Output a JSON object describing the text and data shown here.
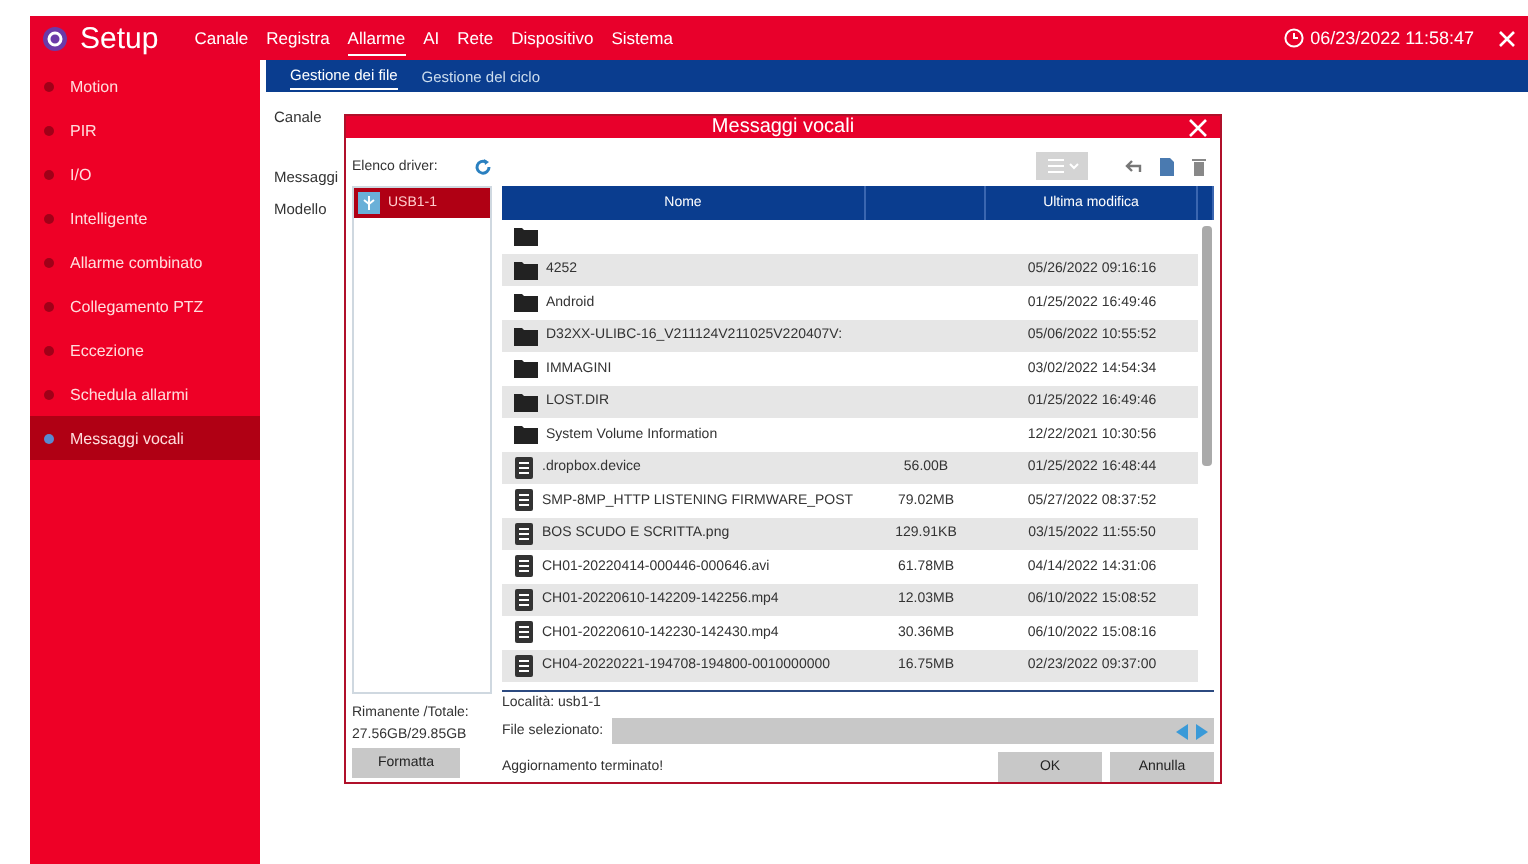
{
  "header": {
    "title": "Setup",
    "nav": [
      {
        "label": "Canale",
        "selected": false
      },
      {
        "label": "Registra",
        "selected": false
      },
      {
        "label": "Allarme",
        "selected": true
      },
      {
        "label": "AI",
        "selected": false
      },
      {
        "label": "Rete",
        "selected": false
      },
      {
        "label": "Dispositivo",
        "selected": false
      },
      {
        "label": "Sistema",
        "selected": false
      }
    ],
    "datetime": "06/23/2022 11:58:47"
  },
  "sidebar": {
    "items": [
      {
        "label": "Motion",
        "selected": false
      },
      {
        "label": "PIR",
        "selected": false
      },
      {
        "label": "I/O",
        "selected": false
      },
      {
        "label": "Intelligente",
        "selected": false
      },
      {
        "label": "Allarme combinato",
        "selected": false
      },
      {
        "label": "Collegamento PTZ",
        "selected": false
      },
      {
        "label": "Eccezione",
        "selected": false
      },
      {
        "label": "Schedula allarmi",
        "selected": false
      },
      {
        "label": "Messaggi vocali",
        "selected": true
      }
    ]
  },
  "subtabs": [
    {
      "label": "Gestione dei file",
      "selected": true
    },
    {
      "label": "Gestione del ciclo",
      "selected": false
    }
  ],
  "form_labels": [
    "Canale",
    "Messaggi",
    "Modello"
  ],
  "dialog": {
    "title": "Messaggi vocali",
    "driver_label": "Elenco driver:",
    "drivers": [
      {
        "label": "USB1-1",
        "selected": true
      }
    ],
    "remaining_label": "Rimanente /Totale:",
    "remaining_value": "27.56GB/29.85GB",
    "format_button": "Formatta",
    "columns": [
      "Nome",
      "Ultima modifica"
    ],
    "rows": [
      {
        "kind": "folder"
      },
      {
        "kind": "folder",
        "name": "4252",
        "modified": "05/26/2022 09:16:16"
      },
      {
        "kind": "folder",
        "name": "Android",
        "modified": "01/25/2022 16:49:46"
      },
      {
        "kind": "folder",
        "name": "D32XX-ULIBC-16_V211124V211025V220407V:",
        "modified": "05/06/2022 10:55:52"
      },
      {
        "kind": "folder",
        "name": "IMMAGINI",
        "modified": "03/02/2022 14:54:34"
      },
      {
        "kind": "folder",
        "name": "LOST.DIR",
        "modified": "01/25/2022 16:49:46"
      },
      {
        "kind": "folder",
        "name": "System Volume Information",
        "modified": "12/22/2021 10:30:56"
      },
      {
        "kind": "file",
        "name": ".dropbox.device",
        "size": "56.00B",
        "modified": "01/25/2022 16:48:44"
      },
      {
        "kind": "file",
        "name": "SMP-8MP_HTTP LISTENING FIRMWARE_POST",
        "size": "79.02MB",
        "modified": "05/27/2022 08:37:52"
      },
      {
        "kind": "file",
        "name": "BOS SCUDO E SCRITTA.png",
        "size": "129.91KB",
        "modified": "03/15/2022 11:55:50"
      },
      {
        "kind": "file",
        "name": "CH01-20220414-000446-000646.avi",
        "size": "61.78MB",
        "modified": "04/14/2022 14:31:06"
      },
      {
        "kind": "file",
        "name": "CH01-20220610-142209-142256.mp4",
        "size": "12.03MB",
        "modified": "06/10/2022 15:08:52"
      },
      {
        "kind": "file",
        "name": "CH01-20220610-142230-142430.mp4",
        "size": "30.36MB",
        "modified": "06/10/2022 15:08:16"
      },
      {
        "kind": "file",
        "name": "CH04-20220221-194708-194800-0010000000",
        "size": "16.75MB",
        "modified": "02/23/2022 09:37:00"
      }
    ],
    "location_label": "Località:",
    "location_value": "usb1-1",
    "selected_label": "File selezionato:",
    "status": "Aggiornamento terminato!",
    "buttons": [
      "OK",
      "Annulla"
    ]
  }
}
